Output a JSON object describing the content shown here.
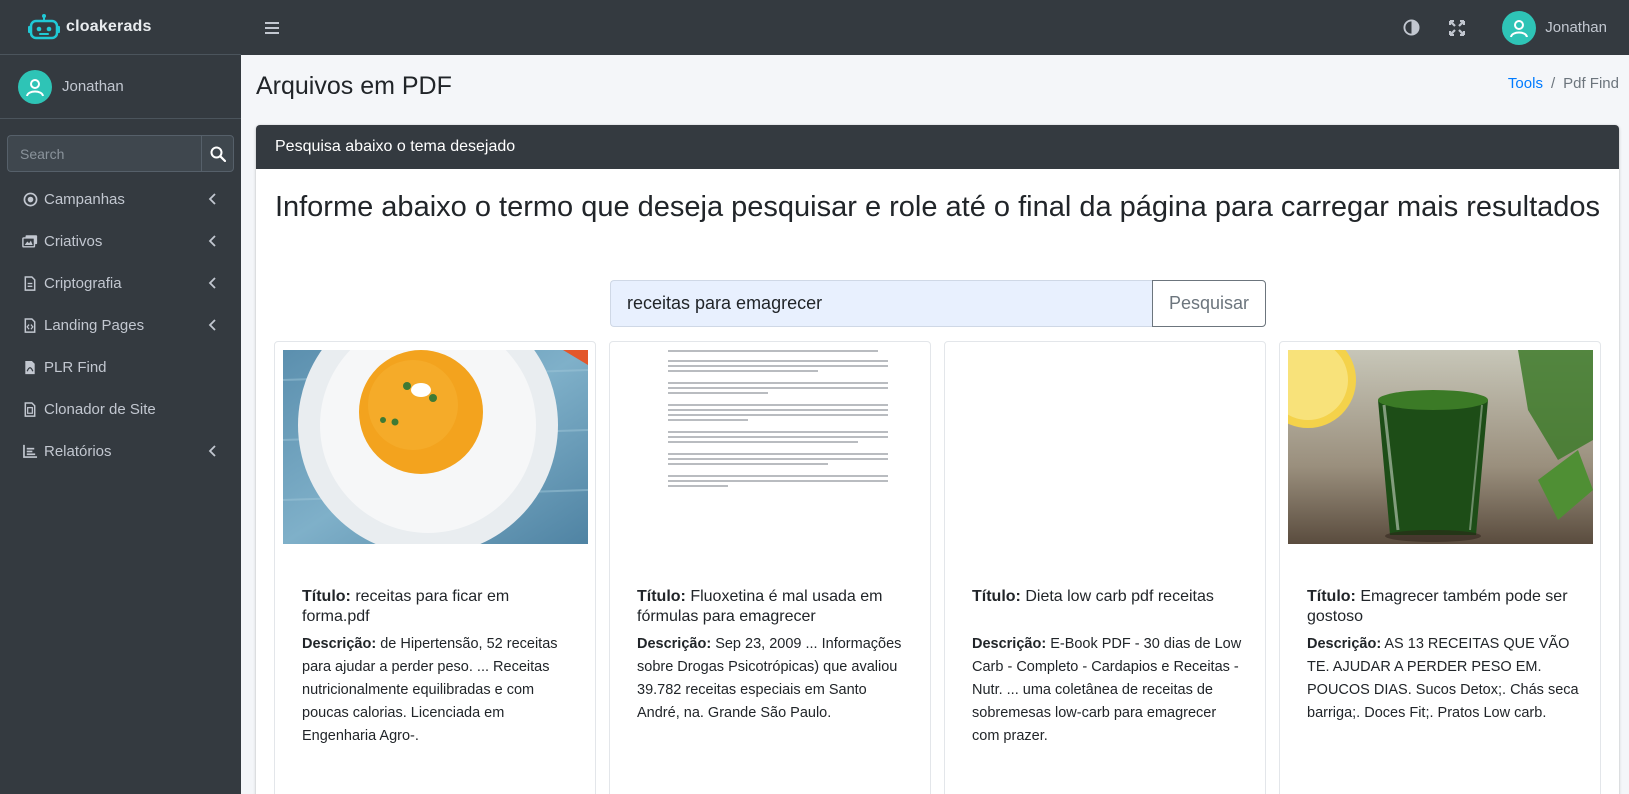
{
  "brand": {
    "name": "cloakerads"
  },
  "user": {
    "name": "Jonathan"
  },
  "sidebar": {
    "search_placeholder": "Search",
    "items": [
      {
        "label": "Campanhas",
        "icon": "circle-dot-icon",
        "has_children": true
      },
      {
        "label": "Criativos",
        "icon": "images-icon",
        "has_children": true
      },
      {
        "label": "Criptografia",
        "icon": "file-icon",
        "has_children": true
      },
      {
        "label": "Landing Pages",
        "icon": "file-code-icon",
        "has_children": true
      },
      {
        "label": "PLR Find",
        "icon": "file-pdf-icon",
        "has_children": false
      },
      {
        "label": "Clonador de Site",
        "icon": "file-copy-icon",
        "has_children": false
      },
      {
        "label": "Relatórios",
        "icon": "chart-icon",
        "has_children": true
      }
    ]
  },
  "topbar": {
    "user_name": "Jonathan"
  },
  "page": {
    "title": "Arquivos em PDF",
    "breadcrumb": {
      "parent": "Tools",
      "current": "Pdf Find"
    }
  },
  "card": {
    "header": "Pesquisa abaixo o tema desejado",
    "lead": "Informe abaixo o termo que deseja pesquisar e role até o final da página para carregar mais resultados",
    "search_value": "receitas para emagrecer",
    "search_button": "Pesquisar"
  },
  "labels": {
    "title": "Título:",
    "description": "Descrição:"
  },
  "results": [
    {
      "title": "receitas para ficar em forma.pdf",
      "description": "de Hipertensão, 52 receitas para ajudar a perder peso. ... Receitas nutricionalmente equilibradas e com poucas calorias. Licenciada em Engenharia Agro-.",
      "thumb": "soup-image"
    },
    {
      "title": "Fluoxetina é mal usada em fórmulas para emagrecer",
      "description": "Sep 23, 2009 ... Informações sobre Drogas Psicotrópicas) que avaliou 39.782 receitas especiais em Santo André, na. Grande São Paulo.",
      "thumb": "document-image"
    },
    {
      "title": "Dieta low carb pdf receitas",
      "description": "E-Book PDF - 30 dias de Low Carb - Completo - Cardapios e Receitas - Nutr. ... uma coletânea de receitas de sobremesas low-carb para emagrecer com prazer.",
      "thumb": "blank-image"
    },
    {
      "title": "Emagrecer também pode ser gostoso",
      "description": "AS 13 RECEITAS QUE VÃO TE. AJUDAR A PERDER PESO EM. POUCOS DIAS. Sucos Detox;. Chás seca barriga;. Doces Fit;. Pratos Low carb.",
      "thumb": "green-juice-image"
    }
  ]
}
